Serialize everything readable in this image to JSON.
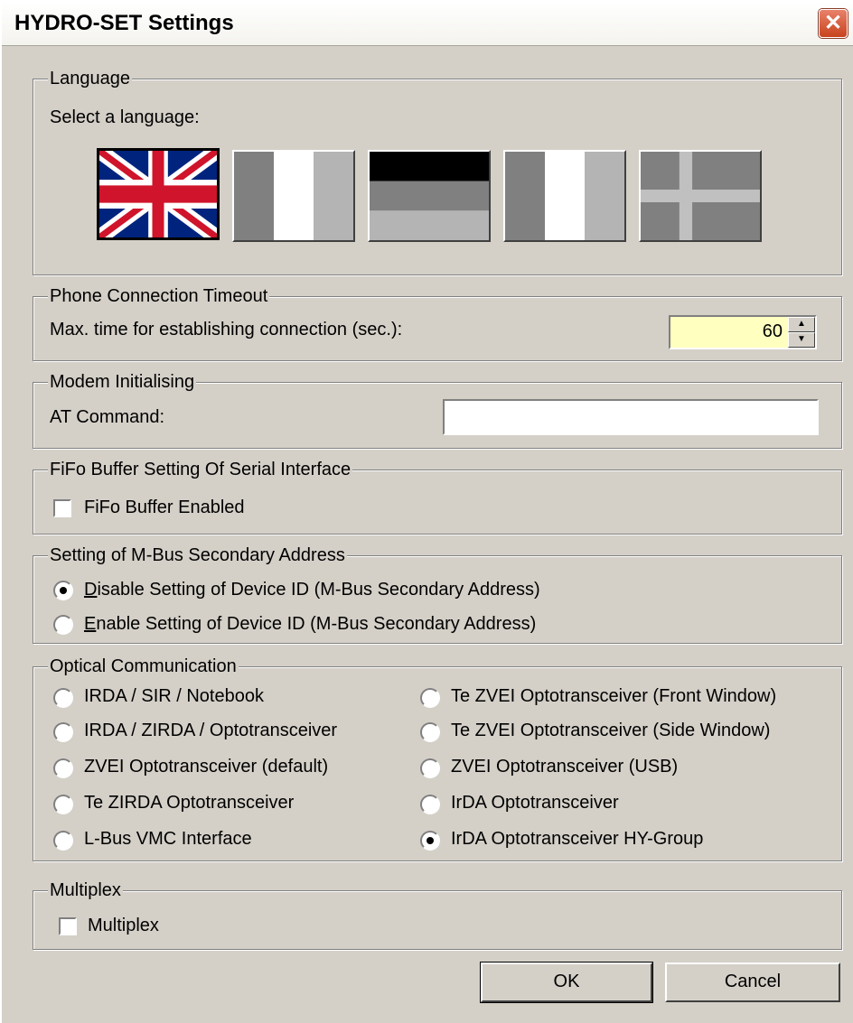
{
  "window": {
    "title": "HYDRO-SET Settings",
    "close_glyph": "✕"
  },
  "language": {
    "legend": "Language",
    "prompt": "Select a language:",
    "flags": [
      {
        "name": "uk-flag-icon",
        "selected": true
      },
      {
        "name": "tricolor-vertical-flag-icon",
        "selected": false
      },
      {
        "name": "tricolor-horizontal-flag-icon",
        "selected": false
      },
      {
        "name": "tricolor-vertical-flag-icon",
        "selected": false
      },
      {
        "name": "nordic-cross-flag-icon",
        "selected": false
      }
    ]
  },
  "phone": {
    "legend": "Phone Connection Timeout",
    "label": "Max. time for establishing connection (sec.):",
    "value": "60"
  },
  "modem": {
    "legend": "Modem Initialising",
    "label": "AT Command:",
    "value": ""
  },
  "fifo": {
    "legend": "FiFo Buffer Setting Of Serial Interface",
    "checkbox_label": "FiFo Buffer Enabled",
    "checked": false
  },
  "mbus": {
    "legend": "Setting of M-Bus Secondary Address",
    "options": [
      {
        "label": "Disable Setting of Device ID (M-Bus Secondary Address)",
        "selected": true
      },
      {
        "label": "Enable Setting of Device ID (M-Bus Secondary Address)",
        "selected": false
      }
    ]
  },
  "optical": {
    "legend": "Optical Communication",
    "left": [
      {
        "label": "IRDA / SIR / Notebook",
        "selected": false
      },
      {
        "label": "IRDA / ZIRDA / Optotransceiver",
        "selected": false
      },
      {
        "label": "ZVEI Optotransceiver (default)",
        "selected": false
      },
      {
        "label": "Te ZIRDA Optotransceiver",
        "selected": false
      },
      {
        "label": "L-Bus VMC Interface",
        "selected": false
      }
    ],
    "right": [
      {
        "label": "Te ZVEI Optotransceiver (Front Window)",
        "selected": false
      },
      {
        "label": "Te ZVEI Optotransceiver (Side Window)",
        "selected": false
      },
      {
        "label": "ZVEI Optotransceiver (USB)",
        "selected": false
      },
      {
        "label": "IrDA Optotransceiver",
        "selected": false
      },
      {
        "label": "IrDA Optotransceiver HY-Group",
        "selected": true
      }
    ]
  },
  "multiplex": {
    "legend": "Multiplex",
    "checkbox_label": "Multiplex",
    "checked": false
  },
  "buttons": {
    "ok": "OK",
    "cancel": "Cancel"
  }
}
